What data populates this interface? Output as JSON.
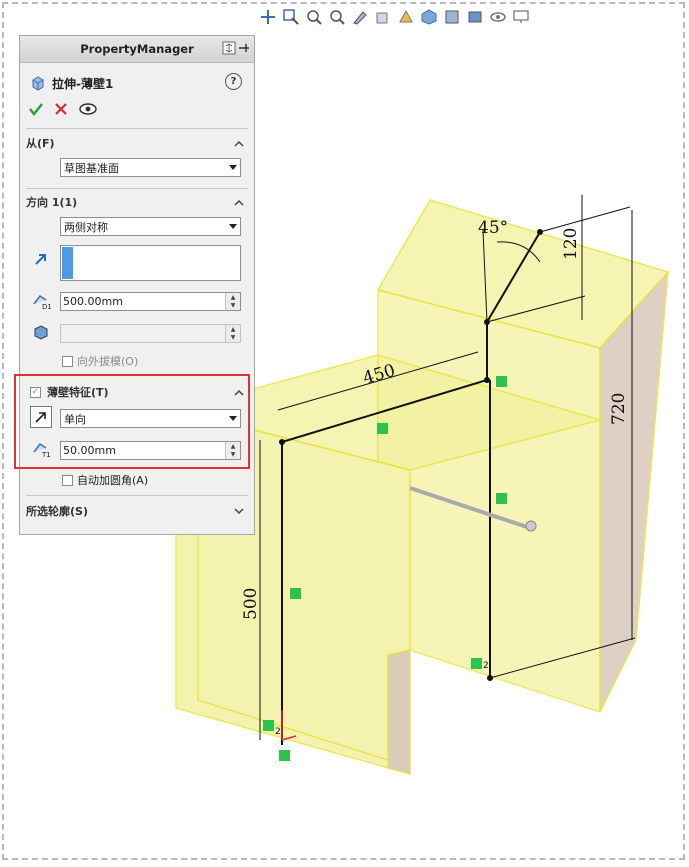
{
  "toolbar": {
    "icons": [
      "zoom-to-fit-icon",
      "zoom-area-icon",
      "previous-view-icon",
      "section-view-icon",
      "dynamic-annotation-icon",
      "view-orientation-icon",
      "display-style-icon",
      "hide-show-icon",
      "edit-appearance-icon",
      "apply-scene-icon",
      "view-settings-icon",
      "monitor-icon"
    ]
  },
  "pm": {
    "title": "PropertyManager",
    "feature_name": "拉伸-薄壁1",
    "help": "?",
    "from": {
      "heading": "从(F)",
      "value": "草图基准面"
    },
    "direction1": {
      "heading": "方向 1(1)",
      "end_condition": "两侧对称",
      "depth": "500.00mm",
      "draft_label": "向外拔模(O)"
    },
    "thin_feature": {
      "heading": "薄壁特征(T)",
      "type": "单向",
      "thickness": "50.00mm",
      "auto_fillet_label": "自动加圆角(A)"
    },
    "selected_contours": {
      "heading": "所选轮廓(S)"
    }
  },
  "dimensions": {
    "angle": "45°",
    "d120": "120",
    "d450": "450",
    "d720": "720",
    "d500": "500"
  },
  "relations": {
    "coincident": "2"
  },
  "colors": {
    "body_fill": "#f3f2a0",
    "body_edge": "#e6e43a",
    "side_face": "#d9c8bc",
    "relation_green": "#2cc34c",
    "highlight_red": "#e03232"
  }
}
